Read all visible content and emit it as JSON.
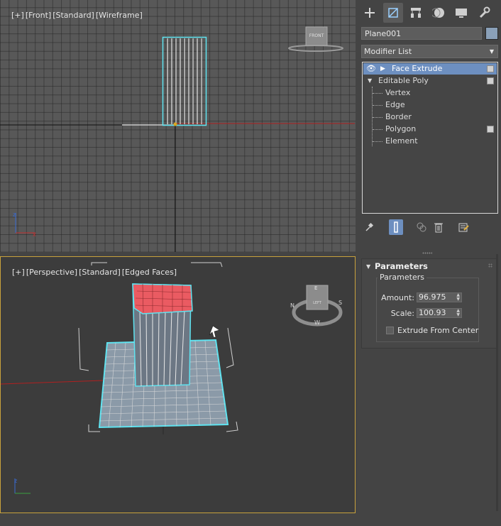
{
  "front_viewport": {
    "labels": [
      "[+]",
      "[Front]",
      "[Standard]",
      "[Wireframe]"
    ],
    "viewcube_label": "FRONT"
  },
  "persp_viewport": {
    "labels": [
      "[+]",
      "[Perspective]",
      "[Standard]",
      "[Edged Faces]"
    ],
    "viewcube_label": "LEFT",
    "compass": [
      "N",
      "S",
      "W",
      "E"
    ]
  },
  "command_panel": {
    "tabs": [
      "create-icon",
      "modify-icon",
      "hierarchy-icon",
      "motion-icon",
      "display-icon",
      "utilities-icon"
    ],
    "active_tab": "modify-icon",
    "object_name": "Plane001",
    "object_color": "#8aa0b8",
    "modifier_list": "Modifier List",
    "stack": {
      "face_extrude": "Face Extrude",
      "editable_poly": "Editable Poly",
      "subobjects": [
        "Vertex",
        "Edge",
        "Border",
        "Polygon",
        "Element"
      ]
    },
    "tools": [
      "pin-stack-icon",
      "show-end-result-icon",
      "make-unique-icon",
      "remove-modifier-icon",
      "configure-modifier-sets-icon"
    ]
  },
  "parameters": {
    "rollout_title": "Parameters",
    "group_title": "Parameters",
    "amount_label": "Amount:",
    "amount_value": "96.975",
    "scale_label": "Scale:",
    "scale_value": "100.93",
    "extrude_center_label": "Extrude From Center",
    "extrude_center_checked": false
  },
  "colors": {
    "selection_cyan": "#5fe3f0",
    "selected_faces": "#e8585f",
    "stack_selection": "#6d8fc0",
    "active_viewport_border": "#c8a23c"
  }
}
